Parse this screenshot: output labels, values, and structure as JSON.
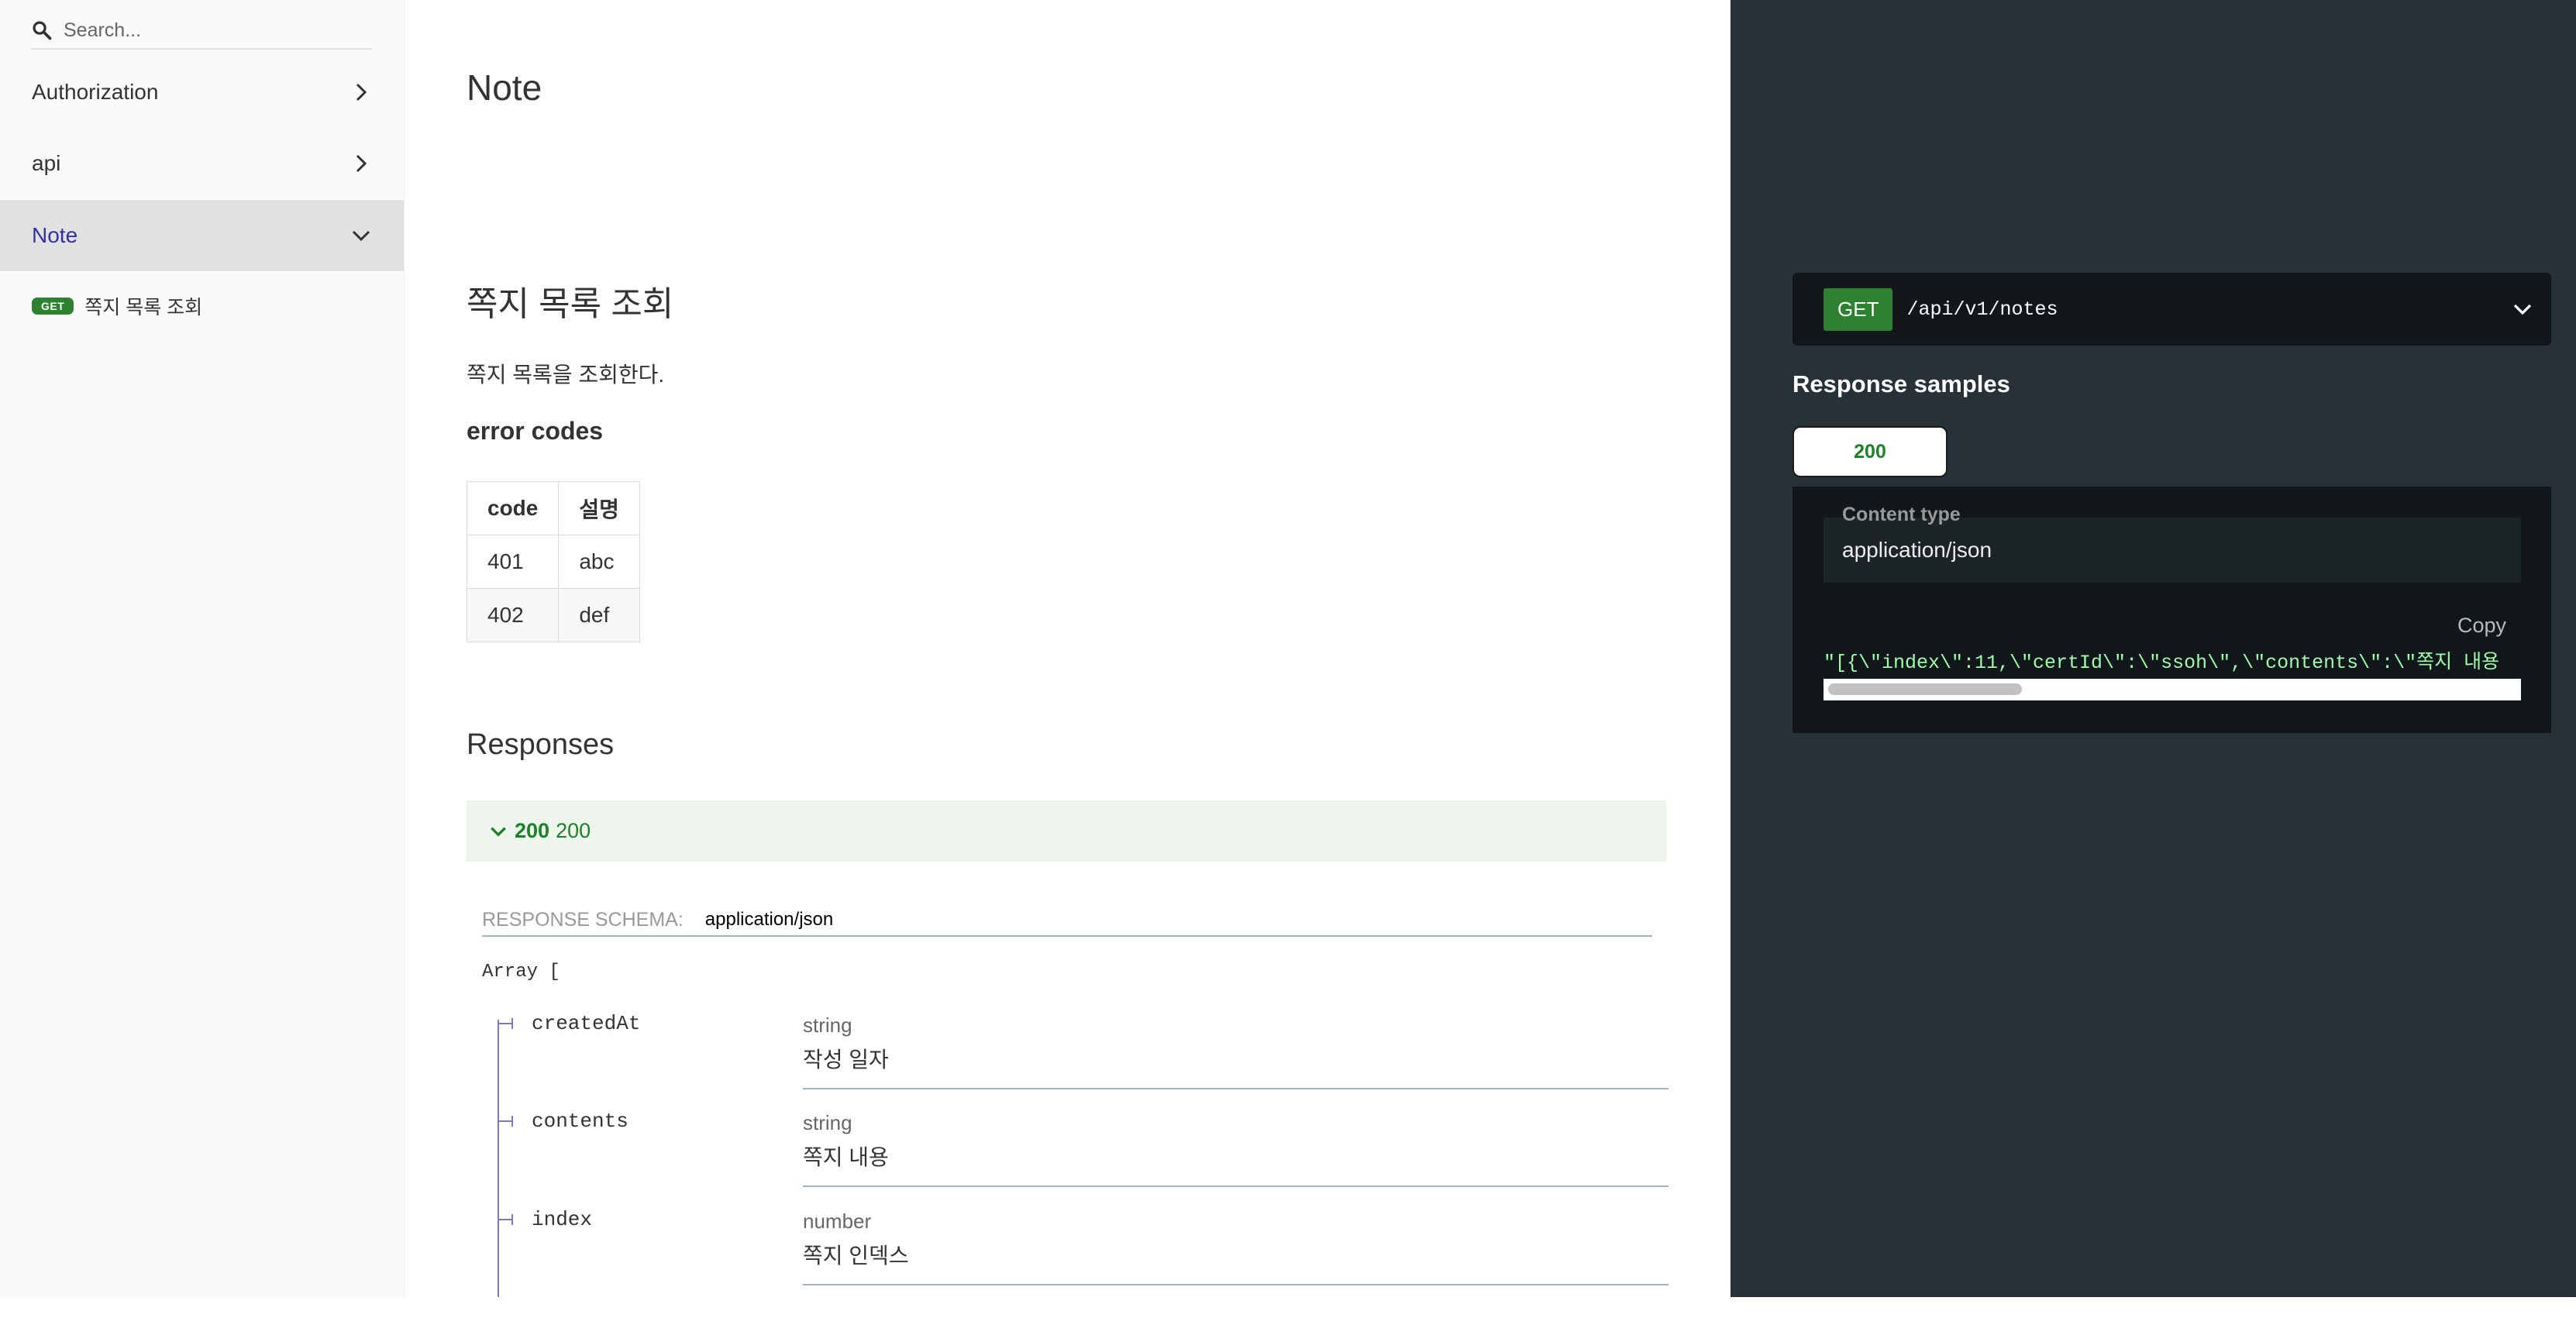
{
  "sidebar": {
    "search_placeholder": "Search...",
    "items": [
      {
        "label": "Authorization"
      },
      {
        "label": "api"
      },
      {
        "label": "Note"
      }
    ],
    "sub_item": {
      "method": "GET",
      "label": "쪽지 목록 조회"
    }
  },
  "main": {
    "title": "Note",
    "operation_title": "쪽지 목록 조회",
    "description": "쪽지 목록을 조회한다.",
    "error_codes_heading": "error codes",
    "error_table": {
      "headers": [
        "code",
        "설명"
      ],
      "rows": [
        [
          "401",
          "abc"
        ],
        [
          "402",
          "def"
        ]
      ]
    },
    "responses_heading": "Responses",
    "response": {
      "code": "200",
      "text": "200"
    },
    "schema_label": "Response Schema:",
    "schema_type": "application/json",
    "array_open": "Array [",
    "properties": [
      {
        "name": "createdAt",
        "type": "string",
        "description": "작성 일자"
      },
      {
        "name": "contents",
        "type": "string",
        "description": "쪽지 내용"
      },
      {
        "name": "index",
        "type": "number",
        "description": "쪽지 인덱스"
      }
    ]
  },
  "right": {
    "method": "GET",
    "path": "/api/v1/notes",
    "samples_title": "Response samples",
    "tab": "200",
    "content_type_label": "Content type",
    "content_type": "application/json",
    "copy_label": "Copy",
    "code": "\"[{\\\"index\\\":11,\\\"certId\\\":\\\"ssoh\\\",\\\"contents\\\":\\\"쪽지 내용"
  },
  "colors": {
    "sidebar_active": "#32329f",
    "get_badge": "#2f8132",
    "success_text": "#1d8127",
    "right_panel": "#263238",
    "code_text": "#a0fbaa"
  }
}
